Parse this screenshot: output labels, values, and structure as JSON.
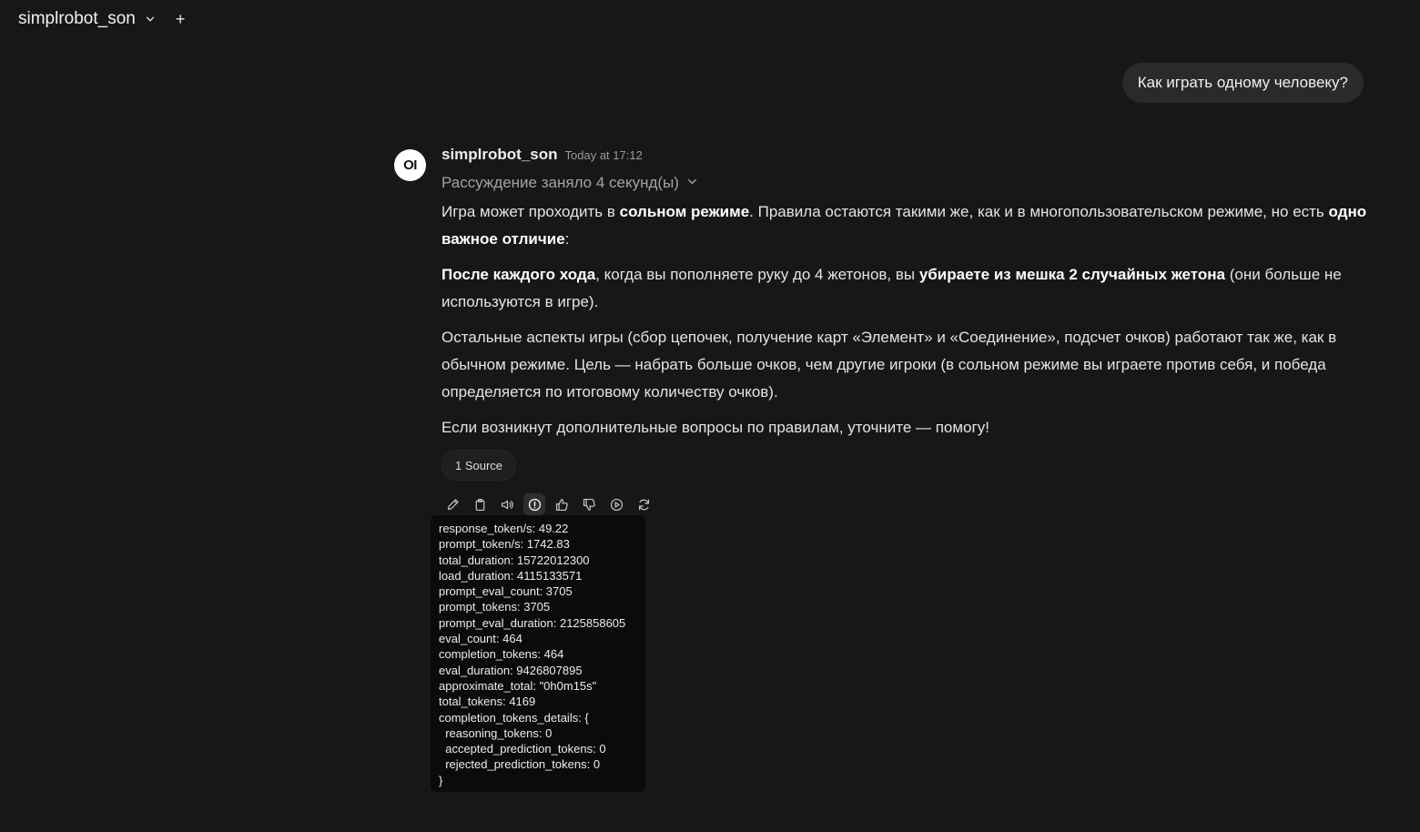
{
  "header": {
    "model_name": "simplrobot_son",
    "new_chat_label": "+"
  },
  "user_message": "Как играть одному человеку?",
  "assistant": {
    "avatar_text": "OI",
    "name": "simplrobot_son",
    "time": "Today at 17:12",
    "reasoning_label": "Рассуждение заняло 4 секунд(ы)",
    "paragraphs": [
      [
        {
          "t": "Игра может проходить в ",
          "b": false
        },
        {
          "t": "сольном режиме",
          "b": true
        },
        {
          "t": ". Правила остаются такими же, как и в многопользовательском режиме, но есть ",
          "b": false
        },
        {
          "t": "одно важное отличие",
          "b": true
        },
        {
          "t": ":",
          "b": false
        }
      ],
      [
        {
          "t": "После каждого хода",
          "b": true
        },
        {
          "t": ", когда вы пополняете руку до 4 жетонов, вы ",
          "b": false
        },
        {
          "t": "убираете из мешка 2 случайных жетона",
          "b": true
        },
        {
          "t": " (они больше не используются в игре).",
          "b": false
        }
      ],
      [
        {
          "t": "Остальные аспекты игры (сбор цепочек, получение карт «Элемент» и «Соединение», подсчет очков) работают так же, как в обычном режиме. Цель — набрать больше очков, чем другие игроки (в сольном режиме вы играете против себя, и победа определяется по итоговому количеству очков).",
          "b": false
        }
      ],
      [
        {
          "t": "Если возникнут дополнительные вопросы по правилам, уточните — помогу!",
          "b": false
        }
      ]
    ],
    "source_label": "1 Source",
    "actions": [
      "edit-icon",
      "copy-icon",
      "speaker-icon",
      "info-icon",
      "thumbs-up-icon",
      "thumbs-down-icon",
      "continue-icon",
      "regenerate-icon"
    ]
  },
  "usage_tooltip": [
    "response_token/s: 49.22",
    "prompt_token/s: 1742.83",
    "total_duration: 15722012300",
    "load_duration: 4115133571",
    "prompt_eval_count: 3705",
    "prompt_tokens: 3705",
    "prompt_eval_duration: 2125858605",
    "eval_count: 464",
    "completion_tokens: 464",
    "eval_duration: 9426807895",
    "approximate_total: \"0h0m15s\"",
    "total_tokens: 4169",
    "completion_tokens_details: {",
    "  reasoning_tokens: 0",
    "  accepted_prediction_tokens: 0",
    "  rejected_prediction_tokens: 0",
    "}"
  ]
}
